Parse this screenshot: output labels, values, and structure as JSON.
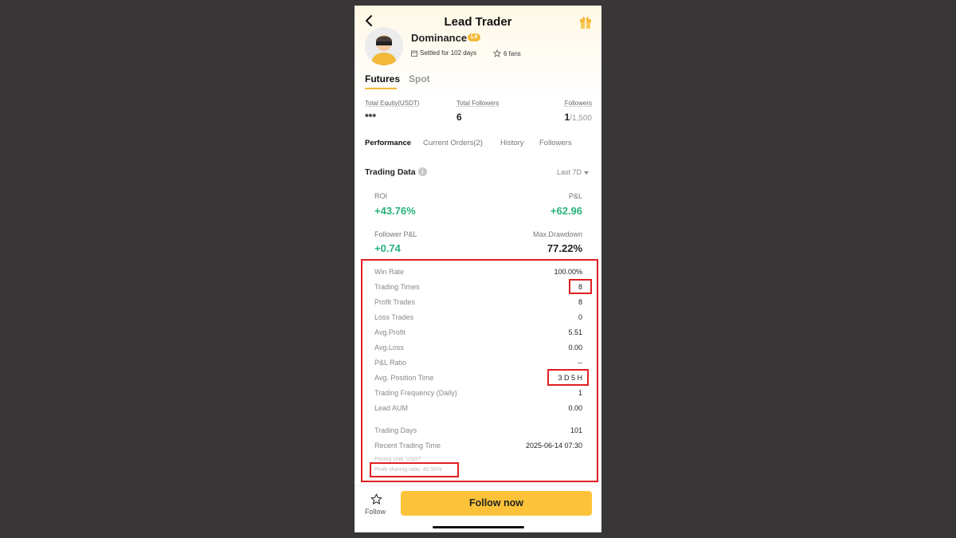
{
  "header": {
    "title": "Lead Trader",
    "back_icon": "chevron-left-icon",
    "gift_icon": "gift-icon"
  },
  "profile": {
    "name": "Dominance",
    "level_badge": "L4",
    "settled": "Settled for 102 days",
    "fans": "6 fans",
    "accent": "#f5b93a"
  },
  "tabs": [
    {
      "label": "Futures",
      "active": true
    },
    {
      "label": "Spot",
      "active": false
    }
  ],
  "stats": {
    "equity_label": "Total Equity(USDT)",
    "equity_value": "***",
    "total_followers_label": "Total Followers",
    "total_followers_value": "6",
    "followers_label": "Followers",
    "followers_value": "1",
    "followers_cap": "/1,500"
  },
  "subtabs": [
    "Performance",
    "Current Orders(2)",
    "History",
    "Followers"
  ],
  "trading_data": {
    "title": "Trading Data",
    "period": "Last 7D",
    "roi_label": "ROI",
    "roi_value": "+43.76%",
    "pnl_label": "P&L",
    "pnl_value": "+62.96",
    "follower_pnl_label": "Follower P&L",
    "follower_pnl_value": "+0.74",
    "max_drawdown_label": "Max.Drawdown",
    "max_drawdown_value": "77.22%",
    "positive_color": "#27b27b"
  },
  "details": [
    {
      "label": "Win Rate",
      "value": "100.00%"
    },
    {
      "label": "Trading Times",
      "value": "8"
    },
    {
      "label": "Profit Trades",
      "value": "8"
    },
    {
      "label": "Loss Trades",
      "value": "0"
    },
    {
      "label": "Avg.Profit",
      "value": "5.51"
    },
    {
      "label": "Avg.Loss",
      "value": "0.00"
    },
    {
      "label": "P&L Ratio",
      "value": "--"
    },
    {
      "label": "Avg. Position Time",
      "value": "3 D 5 H"
    },
    {
      "label": "Trading Frequency (Daily)",
      "value": "1"
    },
    {
      "label": "Lead AUM",
      "value": "0.00"
    },
    {
      "label": "Trading Days",
      "value": "101"
    },
    {
      "label": "Recent Trading Time",
      "value": "2025-06-14 07:30"
    }
  ],
  "footnotes": {
    "pricing_unit": "Pricing Unit: USDT",
    "profit_sharing": "Profit sharing ratio: 40.00%"
  },
  "bottom": {
    "follow_label": "Follow",
    "follow_now": "Follow now",
    "button_color": "#fcc33a"
  },
  "highlight_color": "#e02020"
}
